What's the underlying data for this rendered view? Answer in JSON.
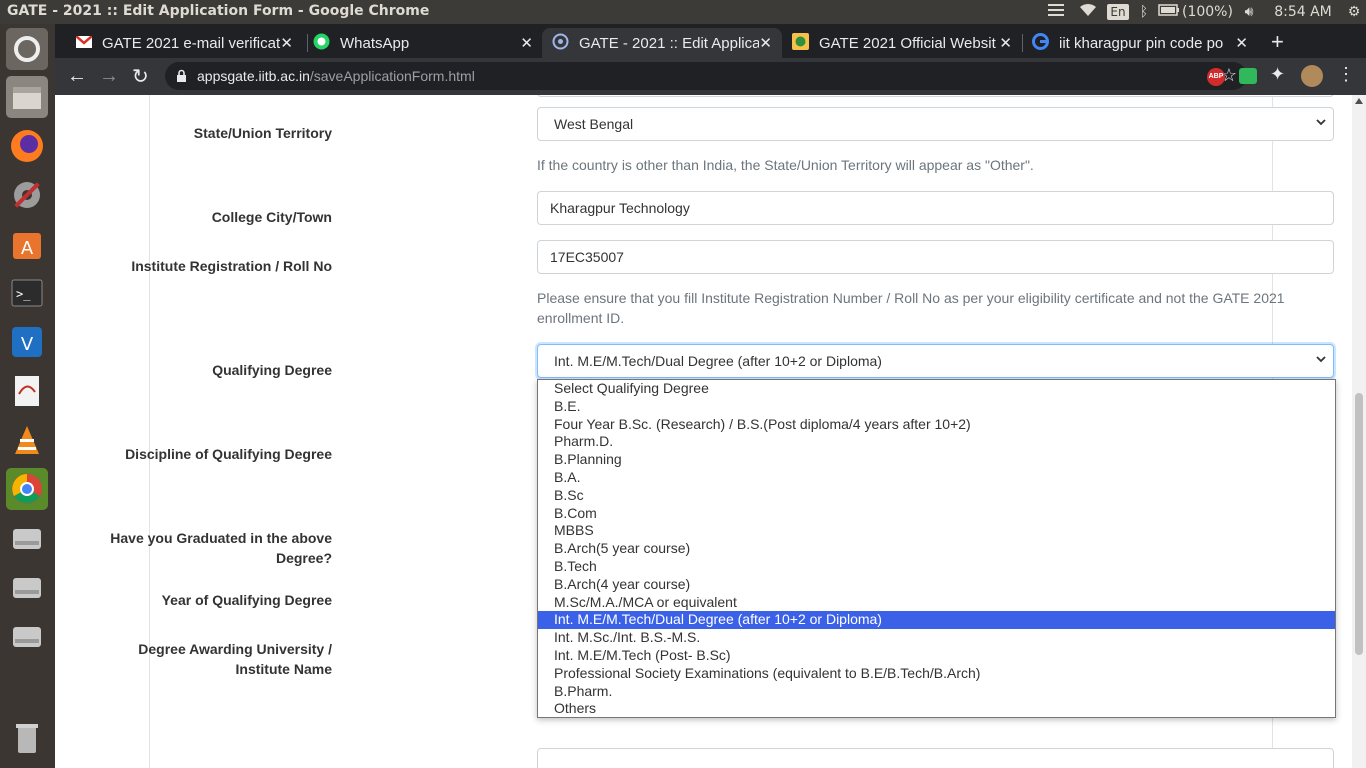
{
  "os": {
    "window_title": "GATE - 2021 :: Edit Application Form - Google Chrome",
    "keyboard_layout": "En",
    "battery": "(100%)",
    "clock": "8:54 AM"
  },
  "browser": {
    "tabs": [
      {
        "label": "GATE 2021 e-mail verificat",
        "icon": "gmail-icon"
      },
      {
        "label": "WhatsApp",
        "icon": "whatsapp-icon"
      },
      {
        "label": "GATE - 2021 :: Edit Applica",
        "icon": "gate-logo-icon"
      },
      {
        "label": "GATE 2021 Official Websit",
        "icon": "gate-site-icon"
      },
      {
        "label": "iit kharagpur pin code po",
        "icon": "google-icon"
      }
    ],
    "url_host": "appsgate.iitb.ac.in",
    "url_path": "/saveApplicationForm.html",
    "abp_badge": "ABP"
  },
  "form": {
    "state_label": "State/Union Territory",
    "state_value": "West Bengal",
    "state_help": "If the country is other than India, the State/Union Territory will appear as \"Other\".",
    "city_label": "College City/Town",
    "city_value": "Kharagpur Technology",
    "roll_label": "Institute Registration / Roll No",
    "roll_value": "17EC35007",
    "roll_help_line1": "Please ensure that you fill Institute Registration Number / Roll No as per your eligibility certificate and not the GATE 2021",
    "roll_help_line2": "enrollment ID.",
    "degree_label": "Qualifying Degree",
    "degree_value": "Int. M.E/M.Tech/Dual Degree (after 10+2 or Diploma)",
    "discipline_label": "Discipline of Qualifying Degree",
    "graduated_label_line1": "Have you Graduated in the above",
    "graduated_label_line2": "Degree?",
    "year_label": "Year of Qualifying Degree",
    "university_label_line1": "Degree Awarding University /",
    "university_label_line2": "Institute Name"
  },
  "degree_options": [
    "Select Qualifying Degree",
    "B.E.",
    "Four Year B.Sc. (Research) / B.S.(Post diploma/4 years after 10+2)",
    "Pharm.D.",
    "B.Planning",
    "B.A.",
    "B.Sc",
    "B.Com",
    "MBBS",
    "B.Arch(5 year course)",
    "B.Tech",
    "B.Arch(4 year course)",
    "M.Sc/M.A./MCA or equivalent",
    "Int. M.E/M.Tech/Dual Degree (after 10+2 or Diploma)",
    "Int. M.Sc./Int. B.S.-M.S.",
    "Int. M.E/M.Tech (Post- B.Sc)",
    "Professional Society Examinations (equivalent to B.E/B.Tech/B.Arch)",
    "B.Pharm.",
    "Others"
  ],
  "selected_index": 13,
  "colors": {
    "highlight": "#3b61e8",
    "chrome_dark": "#202124",
    "ubuntu_bar": "#3c3b37"
  }
}
